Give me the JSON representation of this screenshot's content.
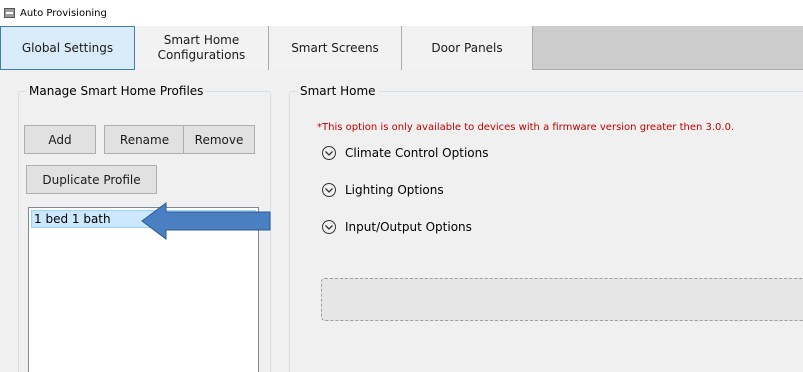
{
  "window": {
    "title": "Auto Provisioning",
    "icon": "app-icon"
  },
  "tabs": [
    {
      "label": "Global Settings",
      "active": true
    },
    {
      "label_line1": "Smart Home",
      "label_line2": "Configurations",
      "active": false
    },
    {
      "label": "Smart Screens",
      "active": false
    },
    {
      "label": "Door Panels",
      "active": false
    }
  ],
  "profiles_panel": {
    "legend": "Manage Smart Home Profiles",
    "add_label": "Add",
    "rename_label": "Rename",
    "remove_label": "Remove",
    "duplicate_label": "Duplicate Profile",
    "items": [
      "1 bed 1 bath"
    ],
    "selected_index": 0
  },
  "smart_home_panel": {
    "legend": "Smart Home",
    "note": "*This option is only available to devices with a firmware version greater then 3.0.0.",
    "expanders": [
      {
        "label": "Climate Control Options",
        "icon": "chevron-down-icon"
      },
      {
        "label": "Lighting Options",
        "icon": "chevron-down-icon"
      },
      {
        "label": "Input/Output Options",
        "icon": "chevron-down-icon"
      }
    ]
  },
  "colors": {
    "active_tab": "#d9ebf9",
    "selected_item": "#cce8ff",
    "note_text": "#c00000",
    "annotation_arrow": "#4a7fc1"
  }
}
